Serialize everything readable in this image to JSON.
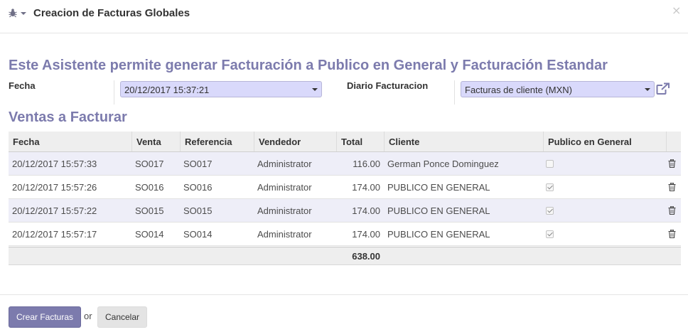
{
  "dialog": {
    "title": "Creacion de Facturas Globales",
    "close_label": "×"
  },
  "form": {
    "intro_text": "Este Asistente permite generar Facturación a Publico en General y Facturación Estandar",
    "fecha_label": "Fecha",
    "fecha_value": "20/12/2017 15:37:21",
    "diario_label": "Diario Facturacion",
    "diario_value": "Facturas de cliente (MXN)",
    "section_title": "Ventas a Facturar"
  },
  "table": {
    "columns": [
      "Fecha",
      "Venta",
      "Referencia",
      "Vendedor",
      "Total",
      "Cliente",
      "Publico en General"
    ],
    "rows": [
      {
        "fecha": "20/12/2017 15:57:33",
        "venta": "SO017",
        "referencia": "SO017",
        "vendedor": "Administrator",
        "total": "116.00",
        "cliente": "German Ponce Dominguez",
        "publico": false
      },
      {
        "fecha": "20/12/2017 15:57:26",
        "venta": "SO016",
        "referencia": "SO016",
        "vendedor": "Administrator",
        "total": "174.00",
        "cliente": "PUBLICO EN GENERAL",
        "publico": true
      },
      {
        "fecha": "20/12/2017 15:57:22",
        "venta": "SO015",
        "referencia": "SO015",
        "vendedor": "Administrator",
        "total": "174.00",
        "cliente": "PUBLICO EN GENERAL",
        "publico": true
      },
      {
        "fecha": "20/12/2017 15:57:17",
        "venta": "SO014",
        "referencia": "SO014",
        "vendedor": "Administrator",
        "total": "174.00",
        "cliente": "PUBLICO EN GENERAL",
        "publico": true
      }
    ],
    "total_sum": "638.00"
  },
  "footer": {
    "create_label": "Crear Facturas",
    "or_label": "or",
    "cancel_label": "Cancelar"
  },
  "colors": {
    "accent": "#7c7bad",
    "select_bg": "#d9d9fb",
    "row_alt": "#eeeef8"
  },
  "icons": {
    "debug": "bug-icon",
    "close": "close-icon",
    "external_link": "external-link-icon",
    "delete": "trash-icon"
  }
}
